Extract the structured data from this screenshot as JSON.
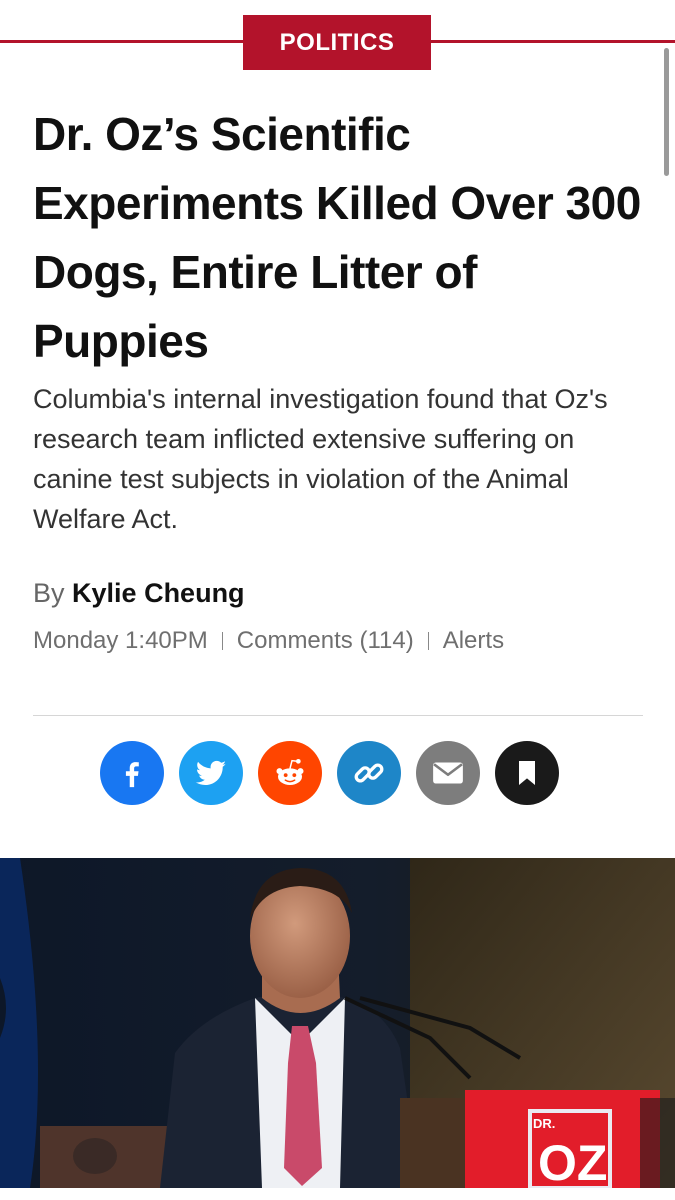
{
  "category": {
    "label": "POLITICS"
  },
  "article": {
    "headline": "Dr. Oz’s Scientific Experiments Killed Over 300 Dogs, Entire Litter of Puppies",
    "dek": "Columbia's internal investigation found that Oz's research team inflicted extensive suffering on canine test subjects in violation of the Animal Welfare Act.",
    "byline_prefix": "By",
    "author": "Kylie Cheung",
    "timestamp": "Monday 1:40PM",
    "comments": "Comments (114)",
    "alerts": "Alerts"
  },
  "share": [
    {
      "name": "facebook",
      "icon": "facebook-icon",
      "color": "#1877f2"
    },
    {
      "name": "twitter",
      "icon": "twitter-icon",
      "color": "#1da1f2"
    },
    {
      "name": "reddit",
      "icon": "reddit-icon",
      "color": "#ff4500"
    },
    {
      "name": "copy-link",
      "icon": "link-icon",
      "color": "#1e86c8"
    },
    {
      "name": "email",
      "icon": "mail-icon",
      "color": "#7d7d7d"
    },
    {
      "name": "bookmark",
      "icon": "bookmark-icon",
      "color": "#1a1a1a"
    }
  ],
  "hero_image": {
    "podium_text": "OZ",
    "podium_small_text": "DR."
  },
  "colors": {
    "accent": "#b3132b"
  }
}
